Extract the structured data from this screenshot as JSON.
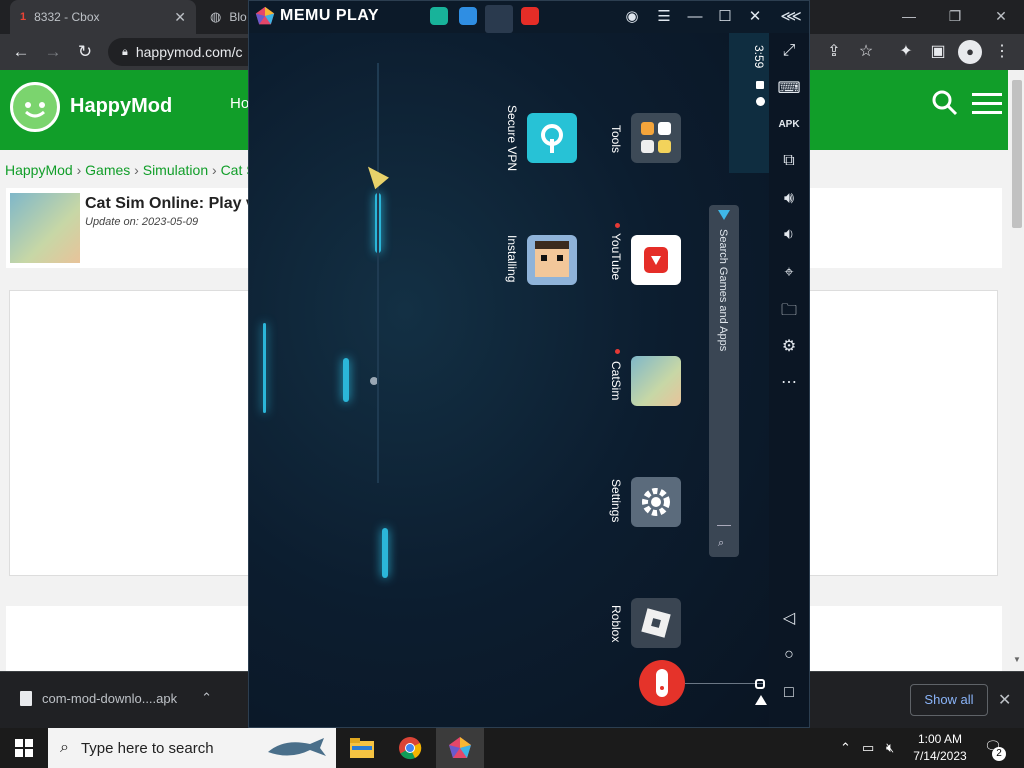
{
  "browser": {
    "tabs": [
      {
        "label": "8332 - Cbox",
        "badge": "1"
      },
      {
        "label": "Blo"
      }
    ],
    "url": "happymod.com/c",
    "window_controls": {
      "minimize": "—",
      "restore": "❐",
      "close": "✕"
    }
  },
  "page": {
    "brand": "HappyMod",
    "nav_partial": "Ho",
    "breadcrumb": [
      "HappyMod",
      "Games",
      "Simulation",
      "Cat Sim"
    ],
    "breadcrumb_sep": "›",
    "app_title": "Cat Sim Online: Play v",
    "app_update": "Update on: 2023-05-09"
  },
  "downloads": {
    "file": "com-mod-downlo....apk",
    "show_all": "Show all",
    "close": "✕"
  },
  "taskbar": {
    "search_placeholder": "Type here to search",
    "time": "1:00 AM",
    "date": "7/14/2023",
    "notif_count": "2"
  },
  "memu": {
    "brand": "MEMU PLAY",
    "status_time": "3:59",
    "launcher_icons": [
      {
        "label": "Secure VPN",
        "color": "#27c2d6",
        "icon": "key-icon"
      },
      {
        "label": "Tools",
        "color": "#3d4a57",
        "icon": "grid-icon"
      },
      {
        "label": "Installing",
        "color": "#8fb3d9",
        "icon": "pixel-face-icon"
      },
      {
        "label": "YouTube",
        "color": "#ffffff",
        "icon": "youtube-icon"
      },
      {
        "label": "CatSim",
        "color": "#c8d5b0",
        "icon": "cat-icon"
      },
      {
        "label": "Settings",
        "color": "#5b6b7c",
        "icon": "gear-icon"
      },
      {
        "label": "Roblox",
        "color": "#3a4552",
        "icon": "roblox-icon"
      }
    ],
    "search_placeholder": "Search Games and Apps",
    "sidebar_icons": [
      "fullscreen-icon",
      "keyboard-icon",
      "apk-icon",
      "multi-instance-icon",
      "volume-up-icon",
      "volume-down-icon",
      "location-icon",
      "folder-icon",
      "settings-icon",
      "more-icon",
      "back-icon",
      "home-icon",
      "recents-icon"
    ],
    "colors": {
      "accent": "#2bb6d9",
      "title_bg": "#0c1a29"
    }
  },
  "colors": {
    "happymod_green": "#119e29",
    "chrome_dark": "#202124"
  }
}
